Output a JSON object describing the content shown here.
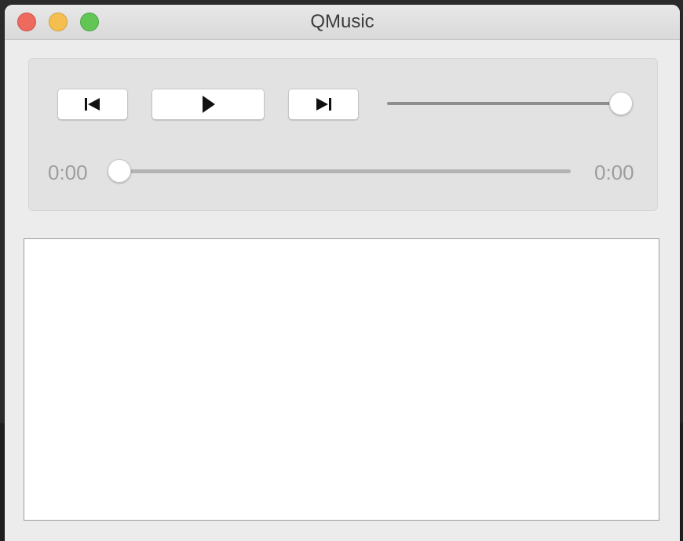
{
  "window": {
    "title": "QMusic"
  },
  "controls": {
    "prev_icon": "skip-previous-icon",
    "play_icon": "play-icon",
    "next_icon": "skip-next-icon",
    "volume_level_percent": 100,
    "progress_percent": 0,
    "elapsed_time": "0:00",
    "total_time": "0:00"
  },
  "playlist": {
    "items": []
  },
  "colors": {
    "close": "#ee6a5f",
    "minimize": "#f5bf4f",
    "maximize": "#62c655"
  }
}
